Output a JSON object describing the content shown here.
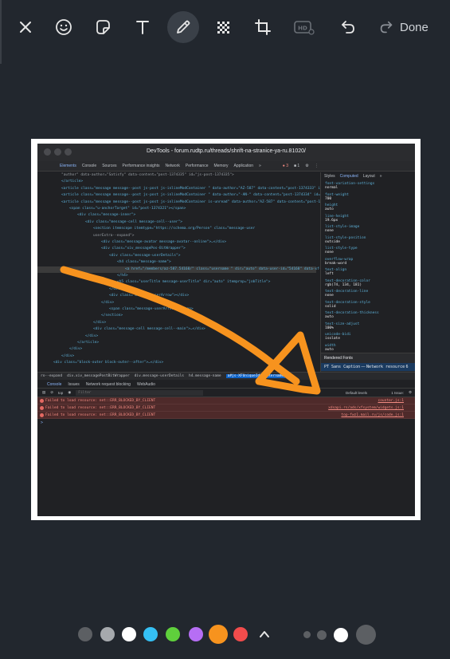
{
  "toolbar": {
    "close_icon": "close-icon",
    "emoji_icon": "emoji-icon",
    "sticker_icon": "sticker-icon",
    "text_icon": "text-icon",
    "pen_icon": "pencil-icon",
    "blur_icon": "checkerboard-icon",
    "crop_icon": "crop-icon",
    "hd_label": "HD",
    "undo_icon": "undo-icon",
    "redo_icon": "redo-icon",
    "done_label": "Done",
    "active_tool": "pencil"
  },
  "devtools": {
    "window_title": "DevTools - forum.rudtp.ru/threads/shrift-na-stranice-ya-ru.81020/",
    "tabs": [
      "Elements",
      "Console",
      "Sources",
      "Performance insights",
      "Network",
      "Performance",
      "Memory",
      "Application"
    ],
    "more_tabs": "»",
    "error_count": "3",
    "issue_count": "1",
    "selected_tab": "Elements",
    "dom_lines": [
      "\"author\" data-author=\"Satisfy\" data-content=\"post-1374335\" id=\"js-post-1374335\">",
      "</article>",
      "<article class=\"message  message--post  js-post js-inlineModContainer  \" data-author=\"AZ-587\" data-content=\"post-1374333\" id=\"js-post-1374333\">…</article>",
      "<article class=\"message  message--post  js-post js-inlineModContainer  \" data-author=\"-AN-\" data-content=\"post-1374334\" id=\"js-post-1374334\">…</article>",
      "<article class=\"message  message--post  js-post js-inlineModContainer   is-unread\" data-author=\"AZ-587\" data-content=\"post-1374321\" id=\"js-post-1374321\">",
      "<span class=\"u-anchorTarget\" id=\"post-1374321\"></span>",
      "<div class=\"message-inner\">",
      "<div class=\"message-cell message-cell--user\">",
      "<section itemscope itemtype=\"https://schema.org/Person\" class=\"message-user",
      "userExtra--expand\">",
      "<div class=\"message-avatar message-avatar--online\">…</div>",
      "<div class=\"xiv_messagePos-BitWrapper\">",
      "<div class=\"message-userDetails\">",
      "<h4 class=\"message-name\">",
      "<a href=\"/members/az-587.54168/\" class=\"username \" dir=\"auto\" data-user-id=\"54168\" data-xf-init=\"member-tooltip\" itemprop=\"name\" id=\"js-XFUniqueId29\">AZ-587</a> == $0",
      "</h4>",
      "<h5 class=\"userTitle message-userTitle\" dir=\"auto\" itemprop=\"jobTitle\">",
      "</div>",
      "<div class=\"message-userArrow\"></div>",
      "</div>",
      "<span class=\"message-userArrow\"></span>",
      "</section>",
      "</div>",
      "<div class=\"message-cell message-cell--main\">…</div>",
      "</div>",
      "</article>",
      "</div>",
      "</div>",
      "<div class=\"block-outer block-outer--after\">…</div>"
    ],
    "side_tabs": [
      "Styles",
      "Computed",
      "Layout",
      "»"
    ],
    "computed_props": [
      {
        "name": "font-variation-settings",
        "value": "normal"
      },
      {
        "name": "font-weight",
        "value": "700"
      },
      {
        "name": "height",
        "value": "auto"
      },
      {
        "name": "line-height",
        "value": "19.6px"
      },
      {
        "name": "list-style-image",
        "value": "none"
      },
      {
        "name": "list-style-position",
        "value": "outside"
      },
      {
        "name": "list-style-type",
        "value": "none"
      },
      {
        "name": "overflow-wrap",
        "value": "break-word"
      },
      {
        "name": "text-align",
        "value": "left"
      },
      {
        "name": "text-decoration-color",
        "value": "rgb(74, 134, 181)"
      },
      {
        "name": "text-decoration-line",
        "value": "none"
      },
      {
        "name": "text-decoration-style",
        "value": "solid"
      },
      {
        "name": "text-decoration-thickness",
        "value": "auto"
      },
      {
        "name": "text-size-adjust",
        "value": "100%"
      },
      {
        "name": "unicode-bidi",
        "value": "isolate"
      },
      {
        "name": "width",
        "value": "auto"
      }
    ],
    "rendered_fonts_header": "Rendered Fonts",
    "rendered_font": "PT Sans Caption",
    "rendered_font_source": "Network resource",
    "rendered_font_glyphs": "6 glyphs",
    "breadcrumbs": [
      "ro--expand",
      "div.xiv_messagePostBitWrapper",
      "div.message-userDetails",
      "h4.message-name",
      "a#js-XFUniqueId29.username"
    ],
    "drawer_tabs": [
      "Console",
      "Issues",
      "Network request blocking",
      "WebAudio"
    ],
    "console_context": "top",
    "console_filter_placeholder": "Filter",
    "default_levels": "Default levels",
    "issues_label": "1 Issue:",
    "issues_count": "1",
    "console_errors": [
      {
        "text": "Failed to load resource: net::ERR_BLOCKED_BY_CLIENT",
        "source": "counter.js:1"
      },
      {
        "text": "Failed to load resource: net::ERR_BLOCKED_BY_CLIENT",
        "source": "xdsapi.rs/ads/xfsystem/widgets.js:1"
      },
      {
        "text": "Failed to load resource: net::ERR_BLOCKED_BY_CLIENT",
        "source": "top-fwz1.mail.ru/js/code.js:1"
      }
    ],
    "prompt": ">"
  },
  "annotation": {
    "color": "#f7931e",
    "shape": "arrow"
  },
  "palette": {
    "colors": [
      "#5c5f63",
      "#a6a9ad",
      "#ffffff",
      "#35c0f4",
      "#5fd03c",
      "#b66ef4",
      "#f7931e",
      "#f24c4c"
    ],
    "selected_color": "#f7931e",
    "more_icon": "chevron-up-icon",
    "brush_sizes": [
      "small",
      "medium",
      "large",
      "x-large"
    ],
    "selected_brush": "large"
  }
}
